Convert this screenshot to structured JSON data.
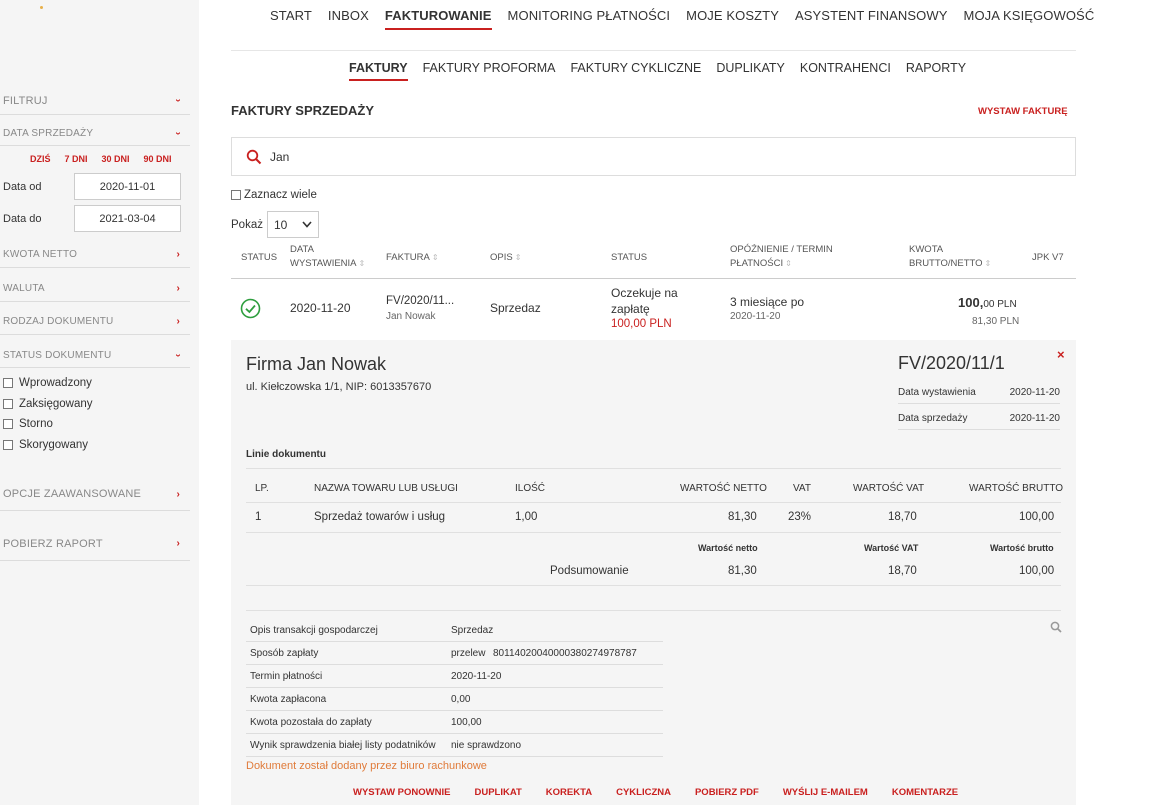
{
  "sidebar": {
    "filtruj": "FILTRUJ",
    "data_sprzedazy": "DATA SPRZEDAŻY",
    "quick": [
      "DZIŚ",
      "7 DNI",
      "30 DNI",
      "90 DNI"
    ],
    "data_od_label": "Data od",
    "data_od_value": "2020-11-01",
    "data_do_label": "Data do",
    "data_do_value": "2021-03-04",
    "kwota_netto": "KWOTA NETTO",
    "waluta": "WALUTA",
    "rodzaj_dokumentu": "RODZAJ DOKUMENTU",
    "status_dokumentu": "STATUS DOKUMENTU",
    "statuses": [
      "Wprowadzony",
      "Zaksięgowany",
      "Storno",
      "Skorygowany"
    ],
    "opcje": "OPCJE ZAAWANSOWANE",
    "pobierz_raport": "POBIERZ RAPORT"
  },
  "topnav": [
    "START",
    "INBOX",
    "FAKTUROWANIE",
    "MONITORING PŁATNOŚCI",
    "MOJE KOSZTY",
    "ASYSTENT FINANSOWY",
    "MOJA KSIĘGOWOŚĆ"
  ],
  "subnav": [
    "FAKTURY",
    "FAKTURY PROFORMA",
    "FAKTURY CYKLICZNE",
    "DUPLIKATY",
    "KONTRAHENCI",
    "RAPORTY"
  ],
  "page": {
    "title": "FAKTURY SPRZEDAŻY",
    "wystaw": "WYSTAW FAKTURĘ",
    "search_value": "Jan",
    "zaznacz": "Zaznacz wiele",
    "pokaz": "Pokaż",
    "pokaz_value": "10"
  },
  "table": {
    "headers": {
      "status": "STATUS",
      "data1": "DATA",
      "data2": "WYSTAWIENIA",
      "faktura": "FAKTURA",
      "opis": "OPIS",
      "status2": "STATUS",
      "opoz1": "OPÓŹNIENIE / TERMIN",
      "opoz2": "PŁATNOŚCI",
      "kwota1": "KWOTA",
      "kwota2": "BRUTTO/NETTO",
      "jpk": "JPK V7"
    },
    "row": {
      "date": "2020-11-20",
      "invoice": "FV/2020/11...",
      "client": "Jan Nowak",
      "opis": "Sprzedaz",
      "status_line1": "Oczekuje na",
      "status_line2": "zapłatę",
      "status_amount": "100,00 PLN",
      "delay": "3 miesiące po",
      "delay_date": "2020-11-20",
      "brutto_int": "100,",
      "brutto_dec": "00 PLN",
      "netto": "81,30 PLN"
    }
  },
  "detail": {
    "firma": "Firma Jan Nowak",
    "address": "ul. Kiełczowska 1/1, NIP: 6013357670",
    "number": "FV/2020/11/1",
    "close": "×",
    "meta": [
      {
        "k": "Data wystawienia",
        "v": "2020-11-20"
      },
      {
        "k": "Data sprzedaży",
        "v": "2020-11-20"
      }
    ],
    "lines_title": "Linie dokumentu",
    "cols": {
      "lp": "LP.",
      "nazwa": "NAZWA TOWARU LUB USŁUGI",
      "ilosc": "ILOŚĆ",
      "netto": "WARTOŚĆ NETTO",
      "vat": "VAT",
      "wvat": "WARTOŚĆ VAT",
      "brutto": "WARTOŚĆ BRUTTO"
    },
    "line": {
      "lp": "1",
      "nazwa": "Sprzedaż towarów i usług",
      "ilosc": "1,00",
      "netto": "81,30",
      "vat": "23%",
      "wvat": "18,70",
      "brutto": "100,00"
    },
    "summary": {
      "h_netto": "Wartość netto",
      "h_vat": "Wartość VAT",
      "h_brutto": "Wartość brutto",
      "label": "Podsumowanie",
      "netto": "81,30",
      "vat": "18,70",
      "brutto": "100,00"
    },
    "info": [
      {
        "k": "Opis transakcji gospodarczej",
        "v": "Sprzedaz"
      },
      {
        "k": "Sposób zapłaty",
        "v": "przelew",
        "v2": "80114020040000380274978787"
      },
      {
        "k": "Termin płatności",
        "v": "2020-11-20"
      },
      {
        "k": "Kwota zapłacona",
        "v": "0,00"
      },
      {
        "k": "Kwota pozostała do zapłaty",
        "v": "100,00"
      },
      {
        "k": "Wynik sprawdzenia białej listy podatników",
        "v": "nie sprawdzono"
      }
    ],
    "dodany": "Dokument został dodany przez biuro rachunkowe",
    "actions": [
      "WYSTAW PONOWNIE",
      "DUPLIKAT",
      "KOREKTA",
      "CYKLICZNA",
      "POBIERZ PDF",
      "WYŚLIJ E-MAILEM",
      "KOMENTARZE"
    ]
  },
  "colors": {
    "accent": "#c9201f",
    "sidebar_bg": "#f5f5f5",
    "success": "#2e9e3e",
    "note": "#e07b3a"
  }
}
